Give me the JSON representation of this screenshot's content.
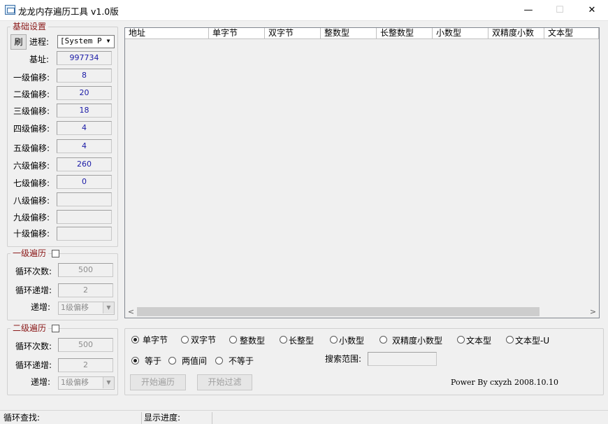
{
  "window": {
    "title": "龙龙内存遍历工具 v1.0版",
    "minimize_glyph": "—",
    "maximize_glyph": "☐",
    "close_glyph": "✕"
  },
  "base_settings": {
    "legend": "基础设置",
    "refresh_label": "刷",
    "process_label": "进程:",
    "process_value": "[System Pr",
    "base_label": "基址:",
    "base_value": "997734",
    "offsets": [
      {
        "label": "一级偏移:",
        "value": "8"
      },
      {
        "label": "二级偏移:",
        "value": "20"
      },
      {
        "label": "三级偏移:",
        "value": "18"
      },
      {
        "label": "四级偏移:",
        "value": "4"
      },
      {
        "label": "五级偏移:",
        "value": "4"
      },
      {
        "label": "六级偏移:",
        "value": "260"
      },
      {
        "label": "七级偏移:",
        "value": "0"
      },
      {
        "label": "八级偏移:",
        "value": ""
      },
      {
        "label": "九级偏移:",
        "value": ""
      },
      {
        "label": "十级偏移:",
        "value": ""
      }
    ]
  },
  "level1_traverse": {
    "legend": "一级遍历",
    "loop_count_label": "循环次数:",
    "loop_count_value": "500",
    "loop_step_label": "循环递增:",
    "loop_step_value": "2",
    "increment_label": "递增:",
    "increment_value": "1级偏移"
  },
  "level2_traverse": {
    "legend": "二级遍历",
    "loop_count_label": "循环次数:",
    "loop_count_value": "500",
    "loop_step_label": "循环递增:",
    "loop_step_value": "2",
    "increment_label": "递增:",
    "increment_value": "1级偏移"
  },
  "results_table": {
    "columns": [
      "地址",
      "单字节",
      "双字节",
      "整数型",
      "长整数型",
      "小数型",
      "双精度小数",
      "文本型"
    ],
    "rows": []
  },
  "options": {
    "type_options": [
      "单字节",
      "双字节",
      "整数型",
      "长整型",
      "小数型",
      "双精度小数型",
      "文本型",
      "文本型-U"
    ],
    "type_selected": "单字节",
    "compare_options": [
      "等于",
      "两值间",
      "不等于"
    ],
    "compare_selected": "等于",
    "search_range_label": "搜索范围:",
    "search_range_value": "",
    "start_traverse_label": "开始遍历",
    "start_filter_label": "开始过滤",
    "credit": "Power By cxyzh 2008.10.10"
  },
  "status": {
    "loop_search_label": "循环查找:",
    "progress_label": "显示进度:"
  }
}
